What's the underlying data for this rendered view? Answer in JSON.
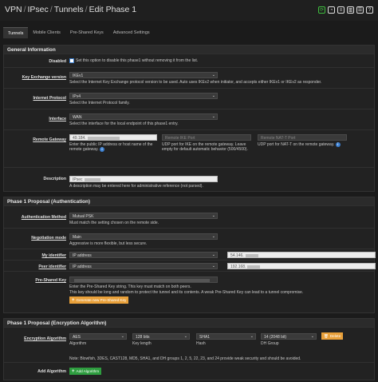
{
  "breadcrumb": {
    "vpn": "VPN",
    "ipsec": "IPsec",
    "tunnels": "Tunnels",
    "current": "Edit Phase 1",
    "sep": "/"
  },
  "tabs": [
    {
      "label": "Tunnels",
      "active": true
    },
    {
      "label": "Mobile Clients",
      "active": false
    },
    {
      "label": "Pre-Shared Keys",
      "active": false
    },
    {
      "label": "Advanced Settings",
      "active": false
    }
  ],
  "general": {
    "title": "General Information",
    "disabled": {
      "label": "Disabled",
      "text": "Set this option to disable this phase1 without removing it from the list."
    },
    "key_exchange": {
      "label": "Key Exchange version",
      "value": "IKEv1",
      "help": "Select the Internet Key Exchange protocol version to be used. Auto uses IKEv2 when initiator, and accepts either IKEv1 or IKEv2 as responder."
    },
    "protocol": {
      "label": "Internet Protocol",
      "value": "IPv4",
      "help": "Select the Internet Protocol family."
    },
    "interface": {
      "label": "Interface",
      "value": "WAN",
      "help": "Select the interface for the local endpoint of this phase1 entry."
    },
    "gateway": {
      "label": "Remote Gateway",
      "value": "49.184.",
      "help": "Enter the public IP address or host name of the remote gateway.",
      "ike_port_placeholder": "Remote IKE Port",
      "ike_port_help": "UDP port for IKE on the remote gateway. Leave empty for default automatic behavior (500/4500).",
      "nat_port_placeholder": "Remote NAT-T Port",
      "nat_port_help": "UDP port for NAT-T on the remote gateway."
    },
    "description": {
      "label": "Description",
      "value": "IPsec",
      "help": "A description may be entered here for administrative reference (not parsed)."
    }
  },
  "auth": {
    "title": "Phase 1 Proposal (Authentication)",
    "method": {
      "label": "Authentication Method",
      "value": "Mutual PSK",
      "help": "Must match the setting chosen on the remote side."
    },
    "negotiation": {
      "label": "Negotiation mode",
      "value": "Main",
      "help": "Aggressive is more flexible, but less secure."
    },
    "my_id": {
      "label": "My identifier",
      "type": "IP address",
      "value": "54.146."
    },
    "peer_id": {
      "label": "Peer identifier",
      "type": "IP address",
      "value": "192.168."
    },
    "psk": {
      "label": "Pre-Shared Key",
      "help1": "Enter the Pre-Shared Key string. This key must match on both peers.",
      "help2": "This key should be long and random to protect the tunnel and its contents. A weak Pre-Shared Key can lead to a tunnel compromise.",
      "generate_label": "Generate new Pre-Shared Key"
    }
  },
  "enc": {
    "title": "Phase 1 Proposal (Encryption Algorithm)",
    "algo_label": "Encryption Algorithm",
    "algorithm": {
      "value": "AES",
      "caption": "Algorithm"
    },
    "key_length": {
      "value": "128 bits",
      "caption": "Key length"
    },
    "hash": {
      "value": "SHA1",
      "caption": "Hash"
    },
    "dh": {
      "value": "14 (2048 bit)",
      "caption": "DH Group"
    },
    "delete_label": "Delete",
    "note": "Note: Blowfish, 3DES, CAST128, MD5, SHA1, and DH groups 1, 2, 5, 22, 23, and 24 provide weak security and should be avoided.",
    "add_label": "Add Algorithm",
    "add_button": "Add Algorithm"
  }
}
